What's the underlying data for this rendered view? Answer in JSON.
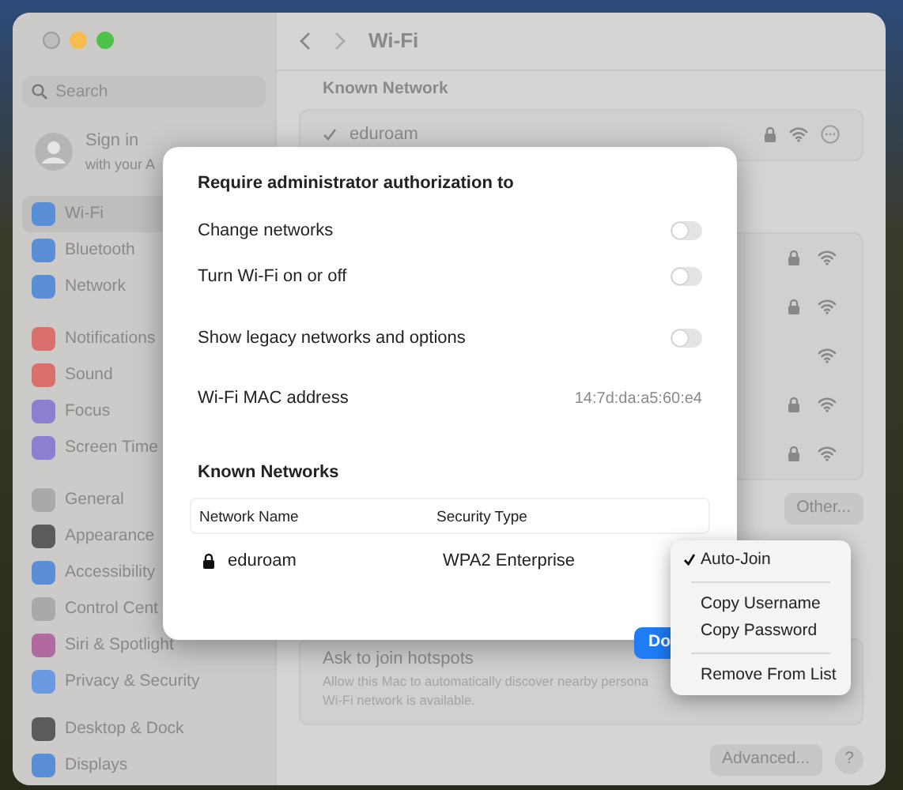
{
  "window": {
    "title": "Wi-Fi"
  },
  "sidebar": {
    "search_placeholder": "Search",
    "account": {
      "title": "Sign in",
      "subtitle": "with your A"
    },
    "groups": [
      [
        {
          "label": "Wi-Fi",
          "selected": true,
          "color": "#5a8fd8"
        },
        {
          "label": "Bluetooth",
          "selected": false,
          "color": "#5a8fd8"
        },
        {
          "label": "Network",
          "selected": false,
          "color": "#5a8fd8"
        }
      ],
      [
        {
          "label": "Notifications",
          "selected": false,
          "color": "#d9706c"
        },
        {
          "label": "Sound",
          "selected": false,
          "color": "#d9706c"
        },
        {
          "label": "Focus",
          "selected": false,
          "color": "#8b7fd0"
        },
        {
          "label": "Screen Time",
          "selected": false,
          "color": "#8b7fd0"
        }
      ],
      [
        {
          "label": "General",
          "selected": false,
          "color": "#a9a9a9"
        },
        {
          "label": "Appearance",
          "selected": false,
          "color": "#5b5b5b"
        },
        {
          "label": "Accessibility",
          "selected": false,
          "color": "#5a8fd8"
        },
        {
          "label": "Control Cent",
          "selected": false,
          "color": "#a9a9a9"
        },
        {
          "label": "Siri & Spotlight",
          "selected": false,
          "color": "#b06aa0"
        },
        {
          "label": "Privacy & Security",
          "selected": false,
          "color": "#6a9be0"
        }
      ],
      [
        {
          "label": "Desktop & Dock",
          "selected": false,
          "color": "#5b5b5b"
        },
        {
          "label": "Displays",
          "selected": false,
          "color": "#5a8fd8"
        }
      ]
    ]
  },
  "content": {
    "known_network": {
      "header": "Known Network",
      "name": "eduroam",
      "connected": true,
      "secured": true
    },
    "networks": [
      {
        "secured": true
      },
      {
        "secured": true
      },
      {
        "secured": false
      },
      {
        "secured": true
      },
      {
        "secured": true
      }
    ],
    "other_button": "Other...",
    "hotspots": {
      "title": "Ask to join hotspots",
      "description_lines": [
        "Allow this Mac to automatically discover nearby persona",
        "Wi-Fi network is available."
      ]
    },
    "advanced_button": "Advanced...",
    "help_button": "?"
  },
  "dialog": {
    "title": "Require administrator authorization to",
    "options": [
      {
        "label": "Change networks",
        "on": false
      },
      {
        "label": "Turn Wi-Fi on or off",
        "on": false
      },
      {
        "label": "Show legacy networks and options",
        "on": false
      }
    ],
    "mac": {
      "label": "Wi-Fi MAC address",
      "value": "14:7d:da:a5:60:e4"
    },
    "known_networks": {
      "title": "Known Networks",
      "columns": [
        "Network Name",
        "Security Type"
      ],
      "rows": [
        {
          "name": "eduroam",
          "security": "WPA2 Enterprise",
          "secured": true
        }
      ]
    },
    "done_button": "Do"
  },
  "context_menu": {
    "items": [
      {
        "kind": "option",
        "label": "Auto-Join",
        "checked": true
      },
      {
        "kind": "divider"
      },
      {
        "kind": "option",
        "label": "Copy Username",
        "checked": false
      },
      {
        "kind": "option",
        "label": "Copy Password",
        "checked": false
      },
      {
        "kind": "divider"
      },
      {
        "kind": "option",
        "label": "Remove From List",
        "checked": false
      }
    ]
  }
}
